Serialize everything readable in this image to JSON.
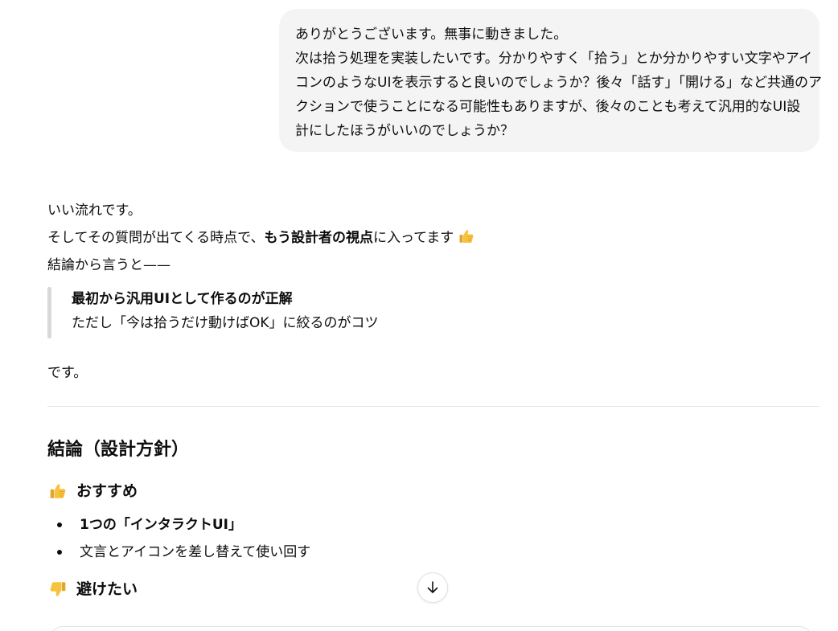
{
  "user_message": {
    "lines": [
      "ありがとうございます。無事に動きました。",
      "次は拾う処理を実装したいです。分かりやすく「拾う」とか分かりやすい文字やアイ",
      "コンのようなUIを表示すると良いのでしょうか？後々「話す」「開ける」など共通のア",
      "クションで使うことになる可能性もありますが、後々のことも考えて汎用的なUI設",
      "計にしたほうがいいのでしょうか？"
    ]
  },
  "assistant": {
    "p1": "いい流れです。",
    "p2_before": "そしてその質問が出てくる時点で、",
    "p2_bold": "もう設計者の視点",
    "p2_after": "に入ってます",
    "p3": "結論から言うと——",
    "quote_bold": "最初から汎用UIとして作るのが正解",
    "quote_text": "ただし「今は拾うだけ動けばOK」に絞るのがコツ",
    "p4": "です。",
    "section_title": "結論（設計方針）",
    "recommend_heading": "おすすめ",
    "recommend_items": [
      "1つの「インタラクトUI」",
      "文言とアイコンを差し替えて使い回す"
    ],
    "avoid_heading": "避けたい"
  },
  "icons": {
    "thumbs_up": "thumbs-up-icon",
    "thumbs_down": "thumbs-down-icon",
    "scroll_down": "arrow-down-icon"
  },
  "colors": {
    "bubble_bg": "#f4f4f4",
    "text": "#0d0d0d",
    "quote_bar": "#d9d9d9",
    "emoji_yellow": "#f7c23c"
  }
}
